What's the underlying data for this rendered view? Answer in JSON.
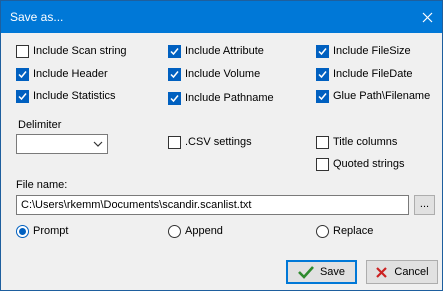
{
  "window": {
    "title": "Save as..."
  },
  "options": {
    "col1": [
      {
        "label": "Include Scan string",
        "checked": false
      },
      {
        "label": "Include Header",
        "checked": true
      },
      {
        "label": "Include Statistics",
        "checked": true
      }
    ],
    "col2": [
      {
        "label": "Include Attribute",
        "checked": true
      },
      {
        "label": "Include Volume",
        "checked": true
      },
      {
        "label": "Include Pathname",
        "checked": true
      }
    ],
    "col3": [
      {
        "label": "Include FileSize",
        "checked": true
      },
      {
        "label": "Include FileDate",
        "checked": true
      },
      {
        "label": "Glue Path\\Filename",
        "checked": true
      }
    ]
  },
  "delimiter": {
    "label": "Delimiter",
    "value": ""
  },
  "csv_settings": {
    "label": ".CSV settings",
    "checked": false
  },
  "title_columns": {
    "label": "Title columns",
    "checked": false
  },
  "quoted_strings": {
    "label": "Quoted strings",
    "checked": false
  },
  "filename": {
    "label": "File name:",
    "value": "C:\\Users\\rkemm\\Documents\\scandir.scanlist.txt",
    "browse_label": "..."
  },
  "mode": [
    {
      "label": "Prompt",
      "selected": true
    },
    {
      "label": "Append",
      "selected": false
    },
    {
      "label": "Replace",
      "selected": false
    }
  ],
  "buttons": {
    "save": "Save",
    "cancel": "Cancel"
  },
  "colors": {
    "accent": "#0078d7",
    "check": "#0060c0",
    "save_check": "#2e8b2e",
    "cancel_x": "#cc2222"
  }
}
